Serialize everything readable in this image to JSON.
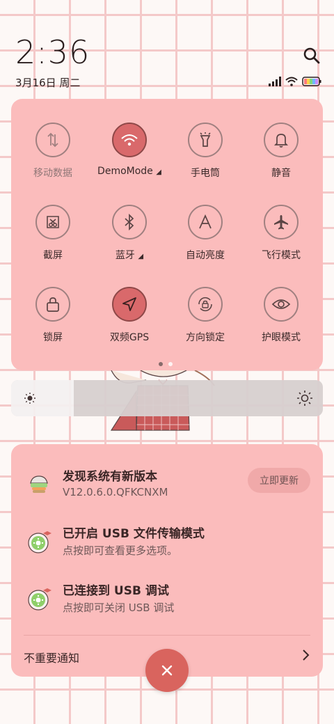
{
  "status": {
    "time": "2:36",
    "date": "3月16日 周二"
  },
  "colors": {
    "panel": "#fbbcbc",
    "active_tile": "#d9696b",
    "clear_button": "#d9645e"
  },
  "quick_settings": {
    "tiles": [
      {
        "label": "移动数据",
        "icon": "mobile-data-icon",
        "active": false,
        "dim": true
      },
      {
        "label": "DemoMode",
        "icon": "wifi-icon",
        "active": true,
        "expand": true
      },
      {
        "label": "手电筒",
        "icon": "flashlight-icon",
        "active": false
      },
      {
        "label": "静音",
        "icon": "bell-icon",
        "active": false
      },
      {
        "label": "截屏",
        "icon": "screenshot-icon",
        "active": false
      },
      {
        "label": "蓝牙",
        "icon": "bluetooth-icon",
        "active": false,
        "expand": true
      },
      {
        "label": "自动亮度",
        "icon": "auto-brightness-icon",
        "active": false
      },
      {
        "label": "飞行模式",
        "icon": "airplane-icon",
        "active": false
      },
      {
        "label": "锁屏",
        "icon": "lock-icon",
        "active": false
      },
      {
        "label": "双频GPS",
        "icon": "gps-icon",
        "active": true
      },
      {
        "label": "方向锁定",
        "icon": "rotation-lock-icon",
        "active": false
      },
      {
        "label": "护眼模式",
        "icon": "eye-icon",
        "active": false
      }
    ],
    "page_count": 2,
    "current_page": 1
  },
  "brightness": {
    "level": 0.2
  },
  "notifications": [
    {
      "title": "发现系统有新版本",
      "subtitle": "V12.0.6.0.QFKCNXM",
      "action": "立即更新",
      "icon": "system-update-icon"
    },
    {
      "title": "已开启 USB 文件传输模式",
      "subtitle": "点按即可查看更多选项。",
      "icon": "android-settings-icon"
    },
    {
      "title": "已连接到 USB 调试",
      "subtitle": "点按即可关闭 USB 调试",
      "icon": "android-settings-icon"
    }
  ],
  "footer": {
    "unimportant_label": "不重要通知"
  }
}
